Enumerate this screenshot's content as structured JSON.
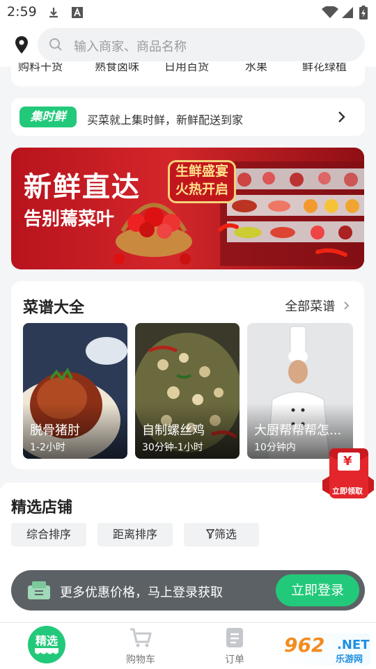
{
  "status_bar": {
    "time": "2:59"
  },
  "search": {
    "placeholder": "输入商家、商品名称"
  },
  "categories": [
    "购料干货",
    "熟食卤味",
    "日用百货",
    "水果",
    "鲜花绿植"
  ],
  "promo": {
    "logo": "集时鲜",
    "text": "买菜就上集时鲜，新鲜配送到家"
  },
  "banner": {
    "title": "新鲜直达",
    "subtitle": "告别蔫菜叶",
    "badge_line1": "生鲜盛宴",
    "badge_line2": "火热开启"
  },
  "recipes": {
    "title": "菜谱大全",
    "all_label": "全部菜谱",
    "items": [
      {
        "name": "脱骨猪肘",
        "time": "1-2小时"
      },
      {
        "name": "自制螺丝鸡",
        "time": "30分钟-1小时"
      },
      {
        "name": "大厨帮帮帮怎...",
        "time": "10分钟内"
      }
    ]
  },
  "red_packet": {
    "label": "立即领取",
    "symbol": "¥"
  },
  "stores": {
    "title": "精选店铺",
    "filters": [
      "综合排序",
      "距离排序",
      "筛选"
    ]
  },
  "login_bar": {
    "text": "更多优惠价格，马上登录获取",
    "button": "立即登录"
  },
  "tabs": [
    {
      "label": "精选",
      "active": true
    },
    {
      "label": "购物车"
    },
    {
      "label": "订单"
    }
  ],
  "watermark": {
    "big": "962",
    "net": ".NET",
    "cn": "乐游网"
  },
  "colors": {
    "accent": "#23c97a",
    "banner_red": "#c81d22"
  }
}
